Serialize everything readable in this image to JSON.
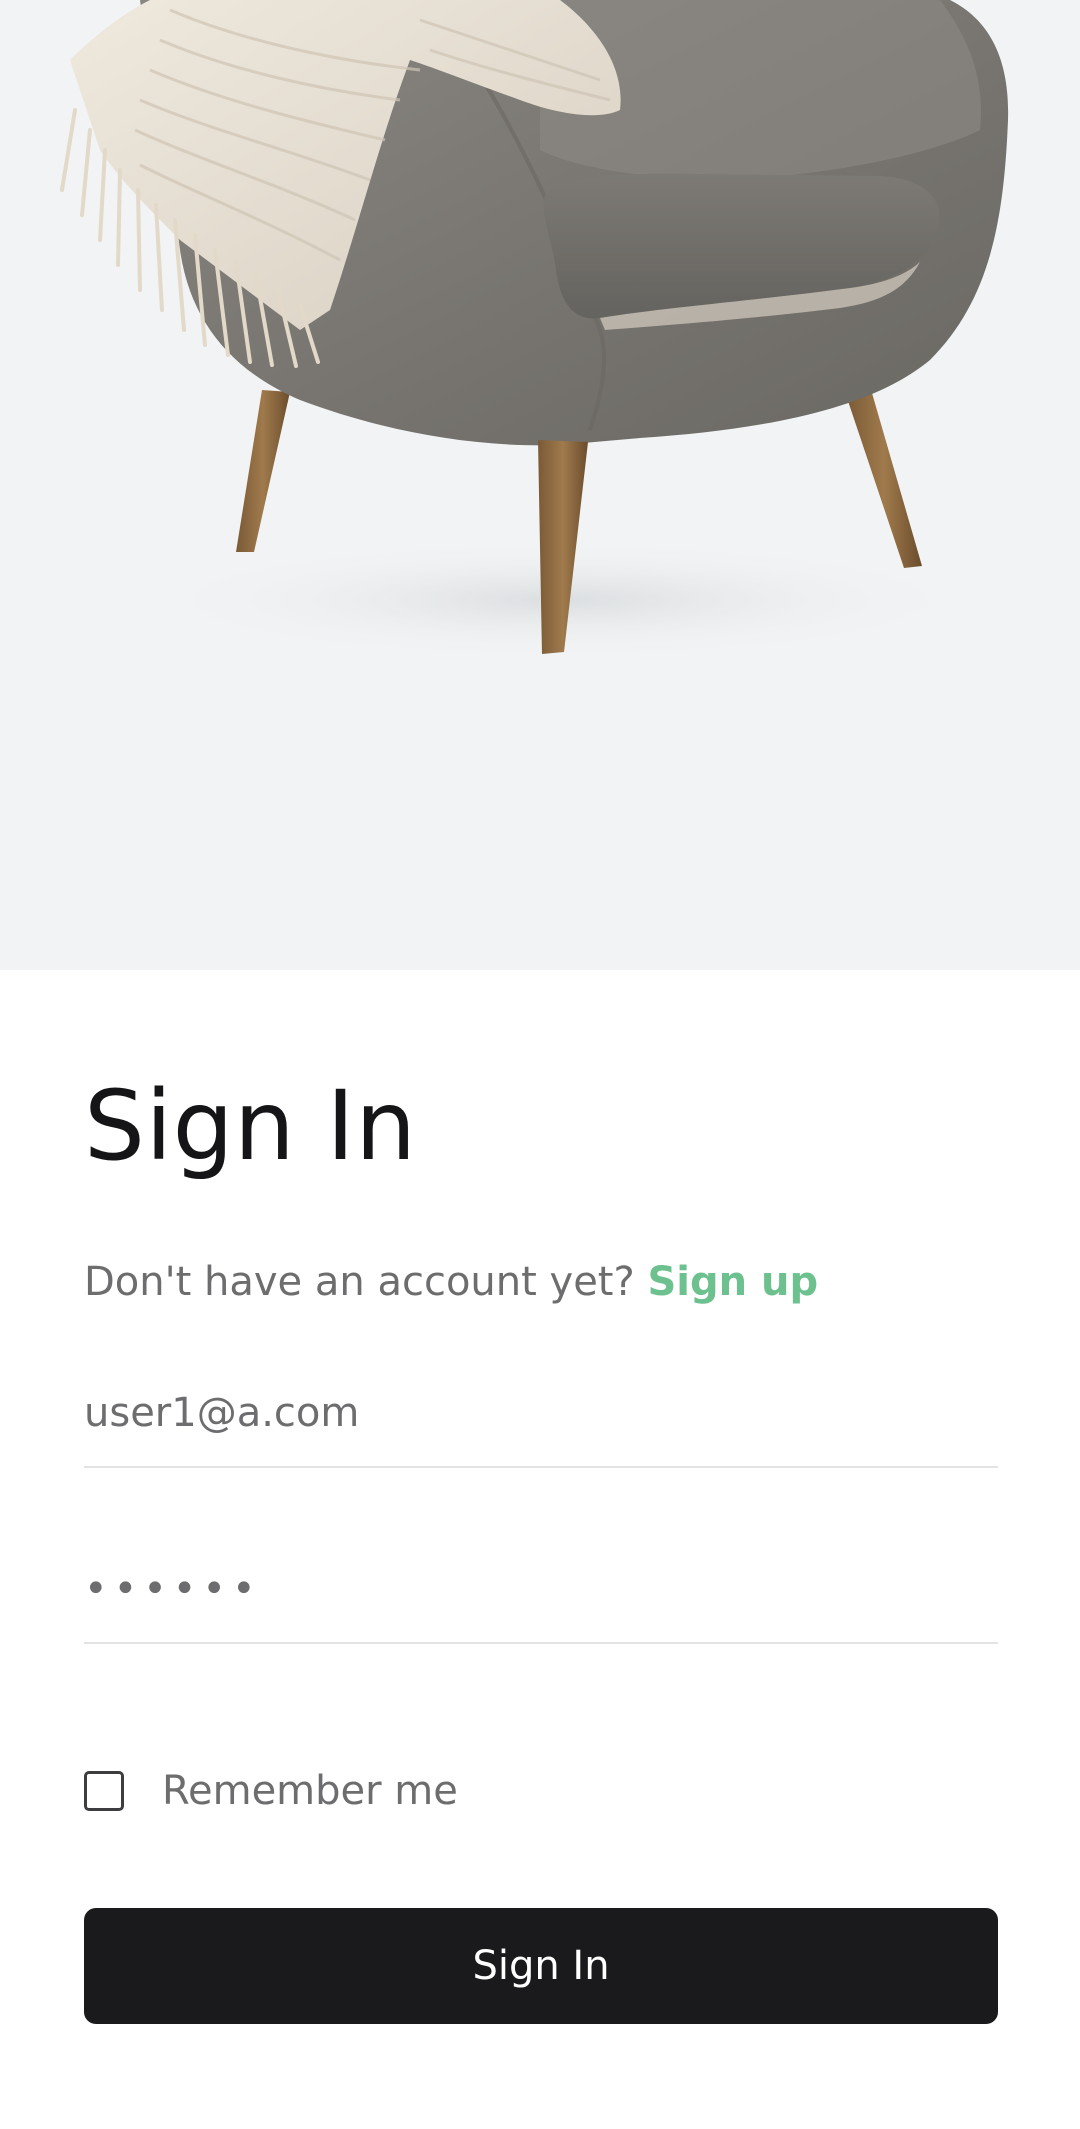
{
  "hero": {
    "image": "armchair-with-blanket-photo"
  },
  "signin": {
    "title": "Sign In",
    "prompt_text": "Don't have an account yet?",
    "signup_link": "Sign up",
    "email_value": "user1@a.com",
    "password_value": "••••••",
    "remember_label": "Remember me",
    "remember_checked": false,
    "submit_label": "Sign In"
  },
  "colors": {
    "hero_background": "#f1f3f4",
    "accent": "#6cc18f",
    "button_background": "#1a1a1c",
    "title_text": "#151518",
    "muted_text": "#6d6d6f"
  }
}
